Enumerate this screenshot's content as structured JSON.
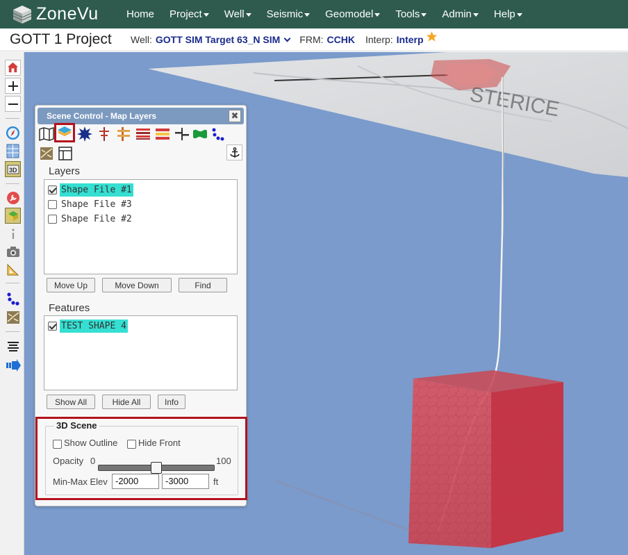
{
  "app": {
    "brand": "ZoneVu"
  },
  "nav": {
    "home": "Home",
    "items": [
      {
        "label": "Project"
      },
      {
        "label": "Well"
      },
      {
        "label": "Seismic"
      },
      {
        "label": "Geomodel"
      },
      {
        "label": "Tools"
      },
      {
        "label": "Admin"
      },
      {
        "label": "Help"
      }
    ]
  },
  "project": {
    "title": "GOTT 1 Project",
    "well_label": "Well:",
    "well_value": "GOTT SIM Target 63_N SIM",
    "frm_label": "FRM:",
    "frm_value": "CCHK",
    "interp_label": "Interp:",
    "interp_value": "Interp"
  },
  "left_toolbar": {
    "icons": [
      "home-icon",
      "zoom-in-icon",
      "zoom-out-icon",
      "compass-icon",
      "grid-view-icon",
      "3d-view-icon",
      "tools-icon",
      "map-layer-icon",
      "info-icon",
      "camera-icon",
      "ruler-icon",
      "scatter-icon",
      "fault-icon",
      "list-icon",
      "export-icon"
    ]
  },
  "panel": {
    "title": "Scene Control - Map Layers",
    "close_glyph": "✖",
    "layers_title": "Layers",
    "layers": [
      {
        "label": "Shape File #1",
        "checked": true,
        "selected": true
      },
      {
        "label": "Shape File #3",
        "checked": false,
        "selected": false
      },
      {
        "label": "Shape File #2",
        "checked": false,
        "selected": false
      }
    ],
    "layer_buttons": {
      "move_up": "Move Up",
      "move_down": "Move Down",
      "find": "Find"
    },
    "features_title": "Features",
    "features": [
      {
        "label": "TEST SHAPE 4",
        "checked": true,
        "selected": true
      }
    ],
    "feature_buttons": {
      "show_all": "Show All",
      "hide_all": "Hide All",
      "info": "Info"
    },
    "scene": {
      "legend": "3D Scene",
      "show_outline": "Show Outline",
      "hide_front": "Hide Front",
      "opacity_label": "Opacity",
      "opacity_min": "0",
      "opacity_max": "100",
      "opacity_value": 50,
      "minmax_label": "Min-Max Elev",
      "min_elev": "-2000",
      "max_elev": "-3000",
      "unit": "ft"
    }
  },
  "colors": {
    "nav_bg": "#2e5b4e",
    "panel_header": "#7c9abf",
    "viewport_bg": "#7a9bcb",
    "highlight_red": "#b3121d",
    "selection": "#35dfd2",
    "link_blue": "#1a2b8c",
    "star": "#f5a623"
  }
}
